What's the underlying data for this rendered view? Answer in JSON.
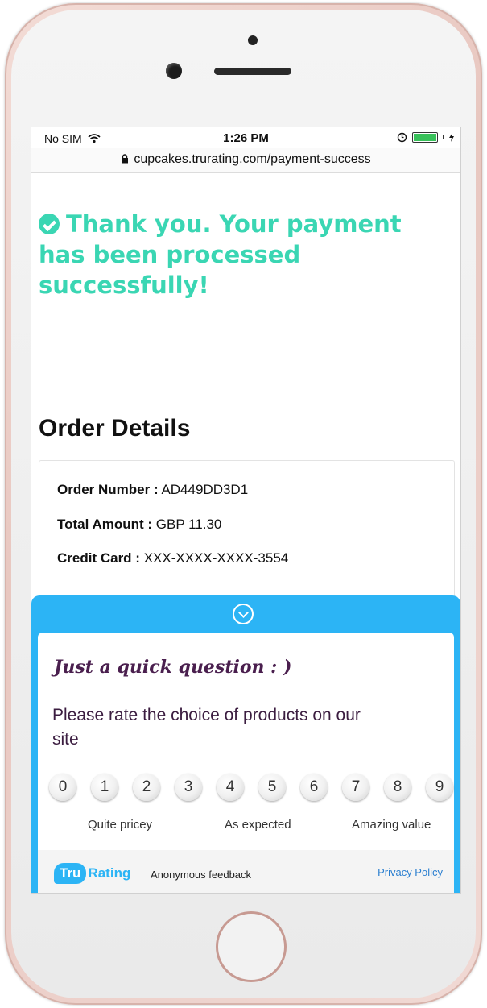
{
  "status_bar": {
    "carrier": "No SIM",
    "time": "1:26 PM"
  },
  "browser": {
    "url": "cupcakes.trurating.com/payment-success"
  },
  "page": {
    "success_message": "Thank you. Your payment has been processed successfully!",
    "order_heading": "Order Details",
    "order": {
      "number_label": "Order Number :",
      "number_value": "AD449DD3D1",
      "total_label": "Total Amount :",
      "total_value": "GBP 11.30",
      "card_label": "Credit Card :",
      "card_value": "XXX-XXXX-XXXX-3554"
    }
  },
  "feedback": {
    "title": "Just a quick question : )",
    "question": "Please rate the choice of products on our site",
    "scale": [
      "0",
      "1",
      "2",
      "3",
      "4",
      "5",
      "6",
      "7",
      "8",
      "9"
    ],
    "labels": {
      "low": "Quite pricey",
      "mid": "As expected",
      "high": "Amazing value"
    },
    "brand_badge": "Tru",
    "brand_rest": "Rating",
    "anonymous_text": "Anonymous feedback",
    "privacy_link": "Privacy Policy"
  },
  "colors": {
    "success_green": "#3ad6b3",
    "widget_blue": "#2cb4f5",
    "question_purple": "#4a1f4e"
  },
  "icons": [
    "wifi-icon",
    "lock-icon",
    "alarm-icon",
    "battery-icon",
    "check-circle-icon",
    "chevron-down-icon"
  ]
}
